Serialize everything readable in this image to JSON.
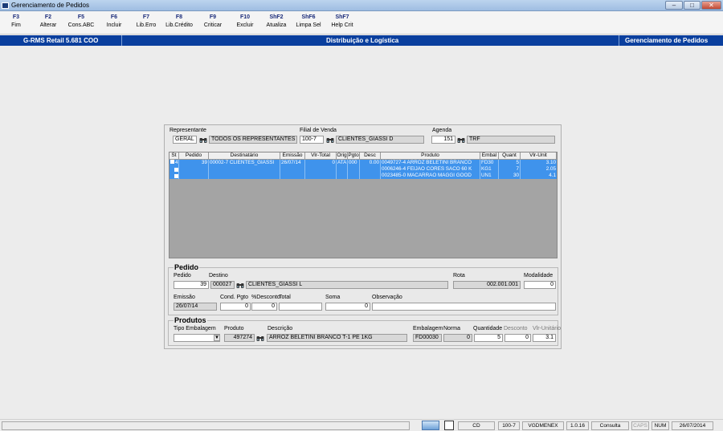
{
  "window": {
    "title": "Gerenciamento de Pedidos"
  },
  "toolbar": [
    {
      "key": "F3",
      "label": "Fim"
    },
    {
      "key": "F2",
      "label": "Alterar"
    },
    {
      "key": "F5",
      "label": "Cons.ABC"
    },
    {
      "key": "F6",
      "label": "Incluir"
    },
    {
      "key": "F7",
      "label": "Lib.Erro"
    },
    {
      "key": "F8",
      "label": "Lib.Crédito"
    },
    {
      "key": "F9",
      "label": "Criticar"
    },
    {
      "key": "F10",
      "label": "Excluir"
    },
    {
      "key": "ShF2",
      "label": "Atualiza"
    },
    {
      "key": "ShF6",
      "label": "Limpa Sel"
    },
    {
      "key": "ShF7",
      "label": "Help Crit"
    }
  ],
  "banner": {
    "left": "G-RMS Retail 5.681 COO",
    "center": "Distribuição e Logística",
    "right": "Gerenciamento de Pedidos"
  },
  "filter": {
    "representante_label": "Representante",
    "representante_code": "GERAL",
    "representante_name": "TODOS OS REPRESENTANTES",
    "filial_label": "Filial de Venda",
    "filial_code": "100-7",
    "filial_name": "CLIENTES_GIASSI D",
    "agenda_label": "Agenda",
    "agenda_code": "151",
    "agenda_name": "TRF"
  },
  "grid": {
    "columns": [
      "St",
      "Pedido",
      "Destinatário",
      "Emissão",
      "Vlr-Total",
      "Orig",
      "Pgto",
      "Desc",
      "Produto",
      "Embal",
      "Quant",
      "Vlr-Unit"
    ],
    "rows": [
      {
        "st": "4",
        "pedido": "39",
        "dest": "00002-7 CLIENTES_GIASSI",
        "emissao": "26/07/14",
        "total": "0",
        "orig": "ATA",
        "pgto": "000",
        "desc": "0.00",
        "produto": "0049727-4 ARROZ BELETINI BRANCO",
        "embal": "FD30",
        "quant": "5",
        "unit": "3.10"
      },
      {
        "st": "",
        "pedido": "",
        "dest": "",
        "emissao": "",
        "total": "",
        "orig": "",
        "pgto": "",
        "desc": "",
        "produto": "0006246-4 FEIJAO CORES SACO 60 K",
        "embal": "KG1",
        "quant": "7",
        "unit": "2.05"
      },
      {
        "st": "",
        "pedido": "",
        "dest": "",
        "emissao": "",
        "total": "",
        "orig": "",
        "pgto": "",
        "desc": "",
        "produto": "0023485-0 MACARRAO MAGGI GOOD",
        "embal": "UN1",
        "quant": "30",
        "unit": "4.1"
      }
    ]
  },
  "pedido": {
    "title": "Pedido",
    "pedido_label": "Pedido",
    "pedido_value": "39",
    "destino_label": "Destino",
    "destino_code": "000027",
    "destino_name": "CLIENTES_GIASSI L",
    "rota_label": "Rota",
    "rota_value": "002.001.001",
    "modalidade_label": "Modalidade",
    "modalidade_value": "0",
    "emissao_label": "Emissão",
    "emissao_value": "26/07/14",
    "cond_label": "Cond. Pgto",
    "cond_value": "0",
    "desconto_label": "%Desconto",
    "desconto_value": "0",
    "total_label": "Total",
    "total_value": "",
    "soma_label": "Soma",
    "soma_value": "0",
    "obs_label": "Observação",
    "obs_value": ""
  },
  "produtos": {
    "title": "Produtos",
    "tipo_label": "Tipo Embalagem",
    "tipo_value": "",
    "produto_label": "Produto",
    "produto_value": "497274",
    "descricao_label": "Descrição",
    "descricao_value": "ARROZ BELETINI BRANCO T-1     PE   1KG",
    "embalagem_label": "Embalagem",
    "embalagem_value": "FD00030",
    "norma_label": "Norma",
    "norma_value": "0",
    "quantidade_label": "Quantidade",
    "quantidade_value": "5",
    "desconto_label": "Desconto",
    "desconto_value": "0",
    "vlr_label": "Vlr-Unitário",
    "vlr_value": "3.1"
  },
  "status": {
    "loja": "CD",
    "filial": "100-7",
    "user": "VGDMENEX",
    "version": "1.0.16",
    "mode": "Consulta",
    "caps": "CAPS",
    "num": "NUM",
    "date": "26/07/2014"
  }
}
